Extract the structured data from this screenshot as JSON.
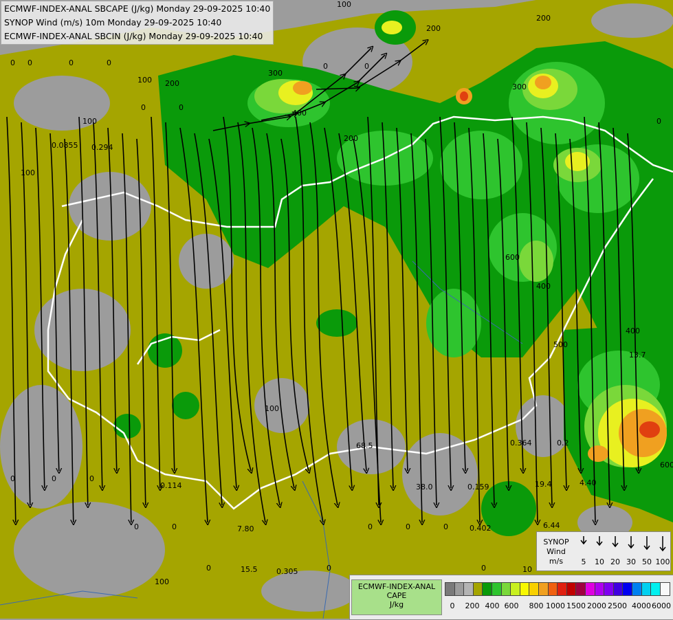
{
  "header": {
    "line1": "ECMWF-INDEX-ANAL SBCAPE (J/kg) Monday 29-09-2025 10:40",
    "line2": "SYNOP Wind (m/s) 10m Monday 29-09-2025 10:40",
    "line3": "ECMWF-INDEX-ANAL SBCIN (J/kg) Monday 29-09-2025 10:40"
  },
  "colors": {
    "cape_0": "#9c9c9c",
    "cape_low": "#a5a500",
    "cape_green_dark": "#0a9a0a",
    "cape_green": "#2ec42e",
    "cape_green_light": "#7ad83a",
    "cape_yellow": "#e8f020",
    "cape_orange": "#f0a020",
    "cape_red": "#e04010",
    "border": "#ffffff",
    "streamline": "#000000"
  },
  "map_labels": [
    {
      "t": "100"
    },
    {
      "t": "100"
    },
    {
      "t": "200"
    },
    {
      "t": "200"
    },
    {
      "t": "200"
    },
    {
      "t": "300"
    },
    {
      "t": "400"
    },
    {
      "t": "0"
    },
    {
      "t": "0"
    },
    {
      "t": "0"
    },
    {
      "t": "0"
    },
    {
      "t": "0"
    },
    {
      "t": "0"
    },
    {
      "t": "0"
    },
    {
      "t": "0"
    },
    {
      "t": "0.0855"
    },
    {
      "t": "0.294"
    },
    {
      "t": "100"
    },
    {
      "t": "100"
    },
    {
      "t": "200"
    },
    {
      "t": "300"
    },
    {
      "t": "400"
    },
    {
      "t": "400"
    },
    {
      "t": "600"
    },
    {
      "t": "500"
    },
    {
      "t": "600"
    },
    {
      "t": "13.7"
    },
    {
      "t": "68.5"
    },
    {
      "t": "38.0"
    },
    {
      "t": "0.159"
    },
    {
      "t": "0.364"
    },
    {
      "t": "0.2"
    },
    {
      "t": "19.4"
    },
    {
      "t": "4.40"
    },
    {
      "t": "0.114"
    },
    {
      "t": "7.80"
    },
    {
      "t": "15.5"
    },
    {
      "t": "0.305"
    },
    {
      "t": "0.402"
    },
    {
      "t": "6.44"
    },
    {
      "t": "10"
    },
    {
      "t": "100"
    },
    {
      "t": "100"
    },
    {
      "t": "0"
    },
    {
      "t": "0"
    },
    {
      "t": "0"
    },
    {
      "t": "0"
    },
    {
      "t": "0"
    },
    {
      "t": "0"
    },
    {
      "t": "0"
    },
    {
      "t": "0"
    },
    {
      "t": "0"
    },
    {
      "t": "0"
    },
    {
      "t": "0"
    },
    {
      "t": "0"
    }
  ],
  "wind_legend": {
    "title1": "SYNOP",
    "title2": "Wind",
    "title3": "m/s",
    "speeds": [
      "5",
      "10",
      "20",
      "30",
      "50",
      "100"
    ]
  },
  "cape_legend": {
    "title1": "ECMWF-INDEX-ANAL",
    "title2": "CAPE",
    "title3": "J/kg",
    "swatches": [
      "#7a7a7a",
      "#9c9c9c",
      "#b4b4b4",
      "#a5a500",
      "#0a9a0a",
      "#2ec42e",
      "#7ad83a",
      "#c8f020",
      "#f8f800",
      "#f8d000",
      "#f0a020",
      "#f06010",
      "#e02010",
      "#c00000",
      "#a00040",
      "#e000e0",
      "#b000f0",
      "#8000f0",
      "#4000e0",
      "#0000f0",
      "#0080f0",
      "#00d0f0",
      "#00f0f0",
      "#f8f8f8"
    ],
    "ticks": [
      "0",
      "200",
      "400",
      "600",
      "800",
      "1000",
      "1500",
      "2000",
      "2500",
      "4000",
      "6000"
    ]
  }
}
